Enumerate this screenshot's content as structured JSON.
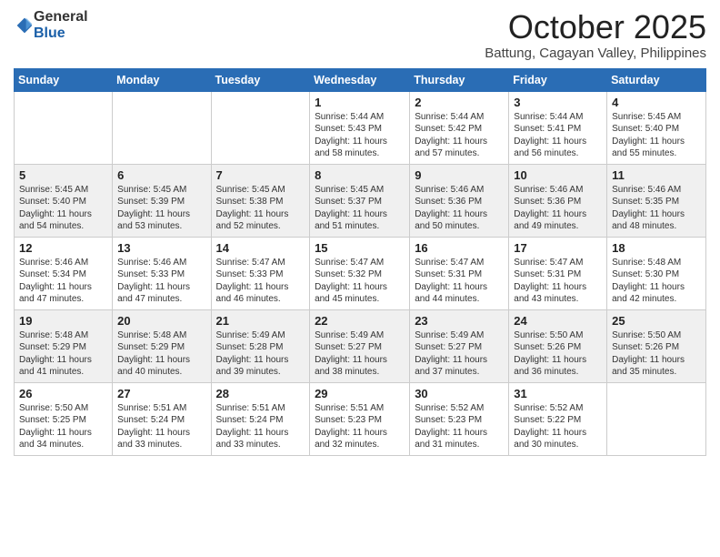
{
  "logo": {
    "general": "General",
    "blue": "Blue"
  },
  "title": "October 2025",
  "subtitle": "Battung, Cagayan Valley, Philippines",
  "header_days": [
    "Sunday",
    "Monday",
    "Tuesday",
    "Wednesday",
    "Thursday",
    "Friday",
    "Saturday"
  ],
  "weeks": [
    [
      {
        "day": "",
        "sunrise": "",
        "sunset": "",
        "daylight": ""
      },
      {
        "day": "",
        "sunrise": "",
        "sunset": "",
        "daylight": ""
      },
      {
        "day": "",
        "sunrise": "",
        "sunset": "",
        "daylight": ""
      },
      {
        "day": "1",
        "sunrise": "Sunrise: 5:44 AM",
        "sunset": "Sunset: 5:43 PM",
        "daylight": "Daylight: 11 hours and 58 minutes."
      },
      {
        "day": "2",
        "sunrise": "Sunrise: 5:44 AM",
        "sunset": "Sunset: 5:42 PM",
        "daylight": "Daylight: 11 hours and 57 minutes."
      },
      {
        "day": "3",
        "sunrise": "Sunrise: 5:44 AM",
        "sunset": "Sunset: 5:41 PM",
        "daylight": "Daylight: 11 hours and 56 minutes."
      },
      {
        "day": "4",
        "sunrise": "Sunrise: 5:45 AM",
        "sunset": "Sunset: 5:40 PM",
        "daylight": "Daylight: 11 hours and 55 minutes."
      }
    ],
    [
      {
        "day": "5",
        "sunrise": "Sunrise: 5:45 AM",
        "sunset": "Sunset: 5:40 PM",
        "daylight": "Daylight: 11 hours and 54 minutes."
      },
      {
        "day": "6",
        "sunrise": "Sunrise: 5:45 AM",
        "sunset": "Sunset: 5:39 PM",
        "daylight": "Daylight: 11 hours and 53 minutes."
      },
      {
        "day": "7",
        "sunrise": "Sunrise: 5:45 AM",
        "sunset": "Sunset: 5:38 PM",
        "daylight": "Daylight: 11 hours and 52 minutes."
      },
      {
        "day": "8",
        "sunrise": "Sunrise: 5:45 AM",
        "sunset": "Sunset: 5:37 PM",
        "daylight": "Daylight: 11 hours and 51 minutes."
      },
      {
        "day": "9",
        "sunrise": "Sunrise: 5:46 AM",
        "sunset": "Sunset: 5:36 PM",
        "daylight": "Daylight: 11 hours and 50 minutes."
      },
      {
        "day": "10",
        "sunrise": "Sunrise: 5:46 AM",
        "sunset": "Sunset: 5:36 PM",
        "daylight": "Daylight: 11 hours and 49 minutes."
      },
      {
        "day": "11",
        "sunrise": "Sunrise: 5:46 AM",
        "sunset": "Sunset: 5:35 PM",
        "daylight": "Daylight: 11 hours and 48 minutes."
      }
    ],
    [
      {
        "day": "12",
        "sunrise": "Sunrise: 5:46 AM",
        "sunset": "Sunset: 5:34 PM",
        "daylight": "Daylight: 11 hours and 47 minutes."
      },
      {
        "day": "13",
        "sunrise": "Sunrise: 5:46 AM",
        "sunset": "Sunset: 5:33 PM",
        "daylight": "Daylight: 11 hours and 47 minutes."
      },
      {
        "day": "14",
        "sunrise": "Sunrise: 5:47 AM",
        "sunset": "Sunset: 5:33 PM",
        "daylight": "Daylight: 11 hours and 46 minutes."
      },
      {
        "day": "15",
        "sunrise": "Sunrise: 5:47 AM",
        "sunset": "Sunset: 5:32 PM",
        "daylight": "Daylight: 11 hours and 45 minutes."
      },
      {
        "day": "16",
        "sunrise": "Sunrise: 5:47 AM",
        "sunset": "Sunset: 5:31 PM",
        "daylight": "Daylight: 11 hours and 44 minutes."
      },
      {
        "day": "17",
        "sunrise": "Sunrise: 5:47 AM",
        "sunset": "Sunset: 5:31 PM",
        "daylight": "Daylight: 11 hours and 43 minutes."
      },
      {
        "day": "18",
        "sunrise": "Sunrise: 5:48 AM",
        "sunset": "Sunset: 5:30 PM",
        "daylight": "Daylight: 11 hours and 42 minutes."
      }
    ],
    [
      {
        "day": "19",
        "sunrise": "Sunrise: 5:48 AM",
        "sunset": "Sunset: 5:29 PM",
        "daylight": "Daylight: 11 hours and 41 minutes."
      },
      {
        "day": "20",
        "sunrise": "Sunrise: 5:48 AM",
        "sunset": "Sunset: 5:29 PM",
        "daylight": "Daylight: 11 hours and 40 minutes."
      },
      {
        "day": "21",
        "sunrise": "Sunrise: 5:49 AM",
        "sunset": "Sunset: 5:28 PM",
        "daylight": "Daylight: 11 hours and 39 minutes."
      },
      {
        "day": "22",
        "sunrise": "Sunrise: 5:49 AM",
        "sunset": "Sunset: 5:27 PM",
        "daylight": "Daylight: 11 hours and 38 minutes."
      },
      {
        "day": "23",
        "sunrise": "Sunrise: 5:49 AM",
        "sunset": "Sunset: 5:27 PM",
        "daylight": "Daylight: 11 hours and 37 minutes."
      },
      {
        "day": "24",
        "sunrise": "Sunrise: 5:50 AM",
        "sunset": "Sunset: 5:26 PM",
        "daylight": "Daylight: 11 hours and 36 minutes."
      },
      {
        "day": "25",
        "sunrise": "Sunrise: 5:50 AM",
        "sunset": "Sunset: 5:26 PM",
        "daylight": "Daylight: 11 hours and 35 minutes."
      }
    ],
    [
      {
        "day": "26",
        "sunrise": "Sunrise: 5:50 AM",
        "sunset": "Sunset: 5:25 PM",
        "daylight": "Daylight: 11 hours and 34 minutes."
      },
      {
        "day": "27",
        "sunrise": "Sunrise: 5:51 AM",
        "sunset": "Sunset: 5:24 PM",
        "daylight": "Daylight: 11 hours and 33 minutes."
      },
      {
        "day": "28",
        "sunrise": "Sunrise: 5:51 AM",
        "sunset": "Sunset: 5:24 PM",
        "daylight": "Daylight: 11 hours and 33 minutes."
      },
      {
        "day": "29",
        "sunrise": "Sunrise: 5:51 AM",
        "sunset": "Sunset: 5:23 PM",
        "daylight": "Daylight: 11 hours and 32 minutes."
      },
      {
        "day": "30",
        "sunrise": "Sunrise: 5:52 AM",
        "sunset": "Sunset: 5:23 PM",
        "daylight": "Daylight: 11 hours and 31 minutes."
      },
      {
        "day": "31",
        "sunrise": "Sunrise: 5:52 AM",
        "sunset": "Sunset: 5:22 PM",
        "daylight": "Daylight: 11 hours and 30 minutes."
      },
      {
        "day": "",
        "sunrise": "",
        "sunset": "",
        "daylight": ""
      }
    ]
  ]
}
